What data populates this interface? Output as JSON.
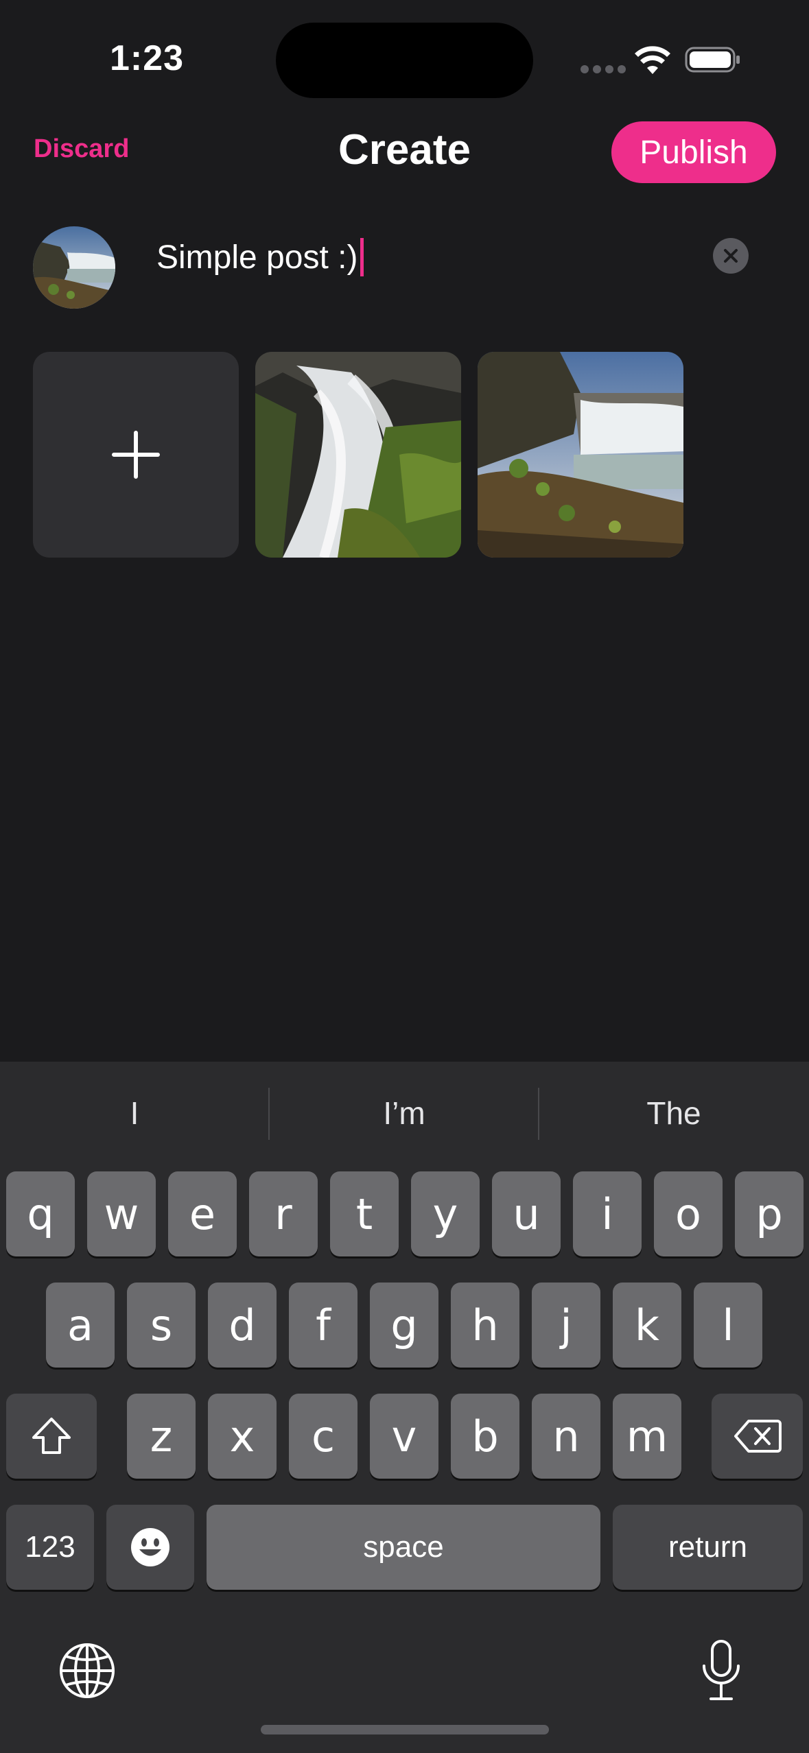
{
  "status_bar": {
    "time": "1:23"
  },
  "header": {
    "discard_label": "Discard",
    "title": "Create",
    "publish_label": "Publish"
  },
  "composer": {
    "text": "Simple post :)"
  },
  "keyboard": {
    "suggestions": [
      "I",
      "I’m",
      "The"
    ],
    "row1": [
      "q",
      "w",
      "e",
      "r",
      "t",
      "y",
      "u",
      "i",
      "o",
      "p"
    ],
    "row2": [
      "a",
      "s",
      "d",
      "f",
      "g",
      "h",
      "j",
      "k",
      "l"
    ],
    "row3": [
      "z",
      "x",
      "c",
      "v",
      "b",
      "n",
      "m"
    ],
    "numbers_label": "123",
    "space_label": "space",
    "return_label": "return"
  },
  "colors": {
    "accent": "#ee2e8b",
    "background": "#1b1b1d",
    "keyboard_bg": "#2b2b2d",
    "key": "#6b6b6e",
    "function_key": "#464649"
  },
  "icons": [
    "signal-icon",
    "wifi-icon",
    "battery-icon",
    "clear-icon",
    "plus-icon",
    "shift-icon",
    "delete-icon",
    "emoji-icon",
    "globe-icon",
    "microphone-icon"
  ]
}
